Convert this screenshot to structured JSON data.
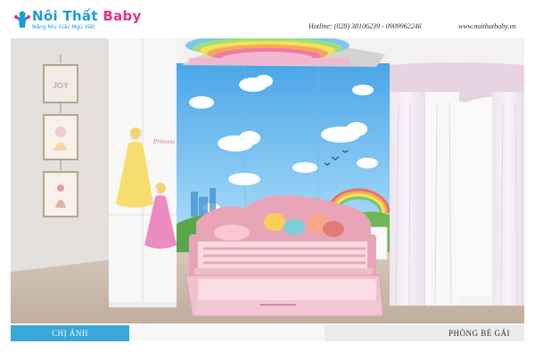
{
  "brand": {
    "name_part1": "Nôi Thất ",
    "name_part2": "Baby",
    "tagline": "Nâng Niu Giấc Ngủ Việt"
  },
  "contact": {
    "hotline": "Hotline: (028) 38106239 - 0909962246",
    "website": "www.noithatbaby.vn"
  },
  "decor": {
    "frame_text": "JOY",
    "wall_text": "Princess"
  },
  "footer": {
    "left_label": "CHỊ ÁNH",
    "right_label": "PHÒNG BÉ GÁI"
  },
  "colors": {
    "brand_blue": "#1f9bd7",
    "brand_pink": "#e2318a",
    "caption_blue": "#3aa7d6"
  }
}
